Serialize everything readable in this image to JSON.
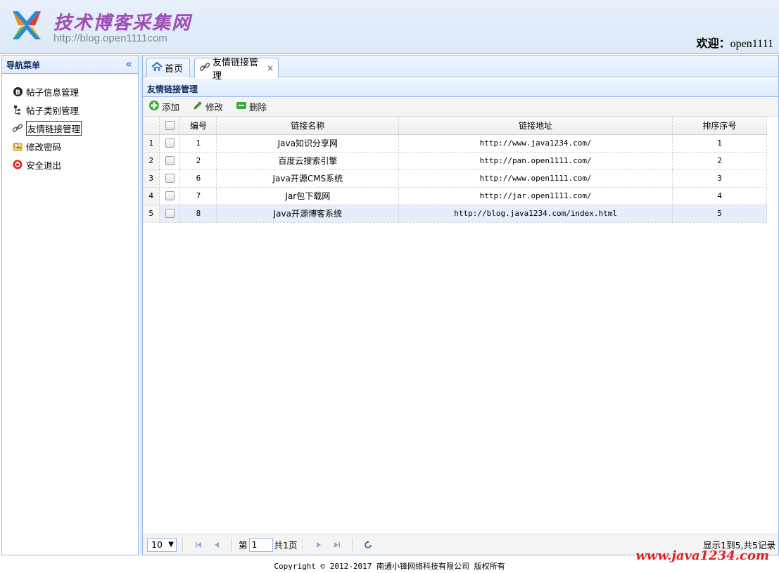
{
  "header": {
    "site_title": "技术博客采集网",
    "site_url": "http://blog.open1111com",
    "welcome_label": "欢迎：",
    "username": "open1111"
  },
  "sidebar": {
    "title": "导航菜单",
    "items": [
      {
        "label": "帖子信息管理",
        "icon": "blog-icon"
      },
      {
        "label": "帖子类别管理",
        "icon": "tree-icon"
      },
      {
        "label": "友情链接管理",
        "icon": "link-icon",
        "active": true
      },
      {
        "label": "修改密码",
        "icon": "key-icon"
      },
      {
        "label": "安全退出",
        "icon": "exit-icon"
      }
    ]
  },
  "tabs": [
    {
      "label": "首页",
      "icon": "home-icon"
    },
    {
      "label": "友情链接管理",
      "icon": "link-icon",
      "active": true,
      "close": "×"
    }
  ],
  "panel": {
    "title": "友情链接管理",
    "toolbar": {
      "add": "添加",
      "edit": "修改",
      "delete": "删除"
    }
  },
  "grid": {
    "columns": [
      "编号",
      "链接名称",
      "链接地址",
      "排序序号"
    ],
    "rows": [
      {
        "rownum": "1",
        "id": "1",
        "name": "Java知识分享网",
        "url": "http://www.java1234.com/",
        "order": "1"
      },
      {
        "rownum": "2",
        "id": "2",
        "name": "百度云搜索引擎",
        "url": "http://pan.open1111.com/",
        "order": "2"
      },
      {
        "rownum": "3",
        "id": "6",
        "name": "Java开源CMS系统",
        "url": "http://www.open1111.com/",
        "order": "3"
      },
      {
        "rownum": "4",
        "id": "7",
        "name": "Jar包下载网",
        "url": "http://jar.open1111.com/",
        "order": "4"
      },
      {
        "rownum": "5",
        "id": "8",
        "name": "Java开源博客系统",
        "url": "http://blog.java1234.com/index.html",
        "order": "5"
      }
    ],
    "selected_row": 5
  },
  "pager": {
    "page_size": "10",
    "page_prefix": "第",
    "page_value": "1",
    "page_suffix": "共1页",
    "info": "显示1到5,共5记录"
  },
  "footer": {
    "copyright": "Copyright © 2012-2017 南通小锋网络科技有限公司 版权所有",
    "watermark": "www.java1234.com"
  },
  "colors": {
    "border": "#95b8e7",
    "header_bg": "#e0ecff",
    "title_purple": "#9b4fb3",
    "watermark_red": "#e31e1e"
  }
}
